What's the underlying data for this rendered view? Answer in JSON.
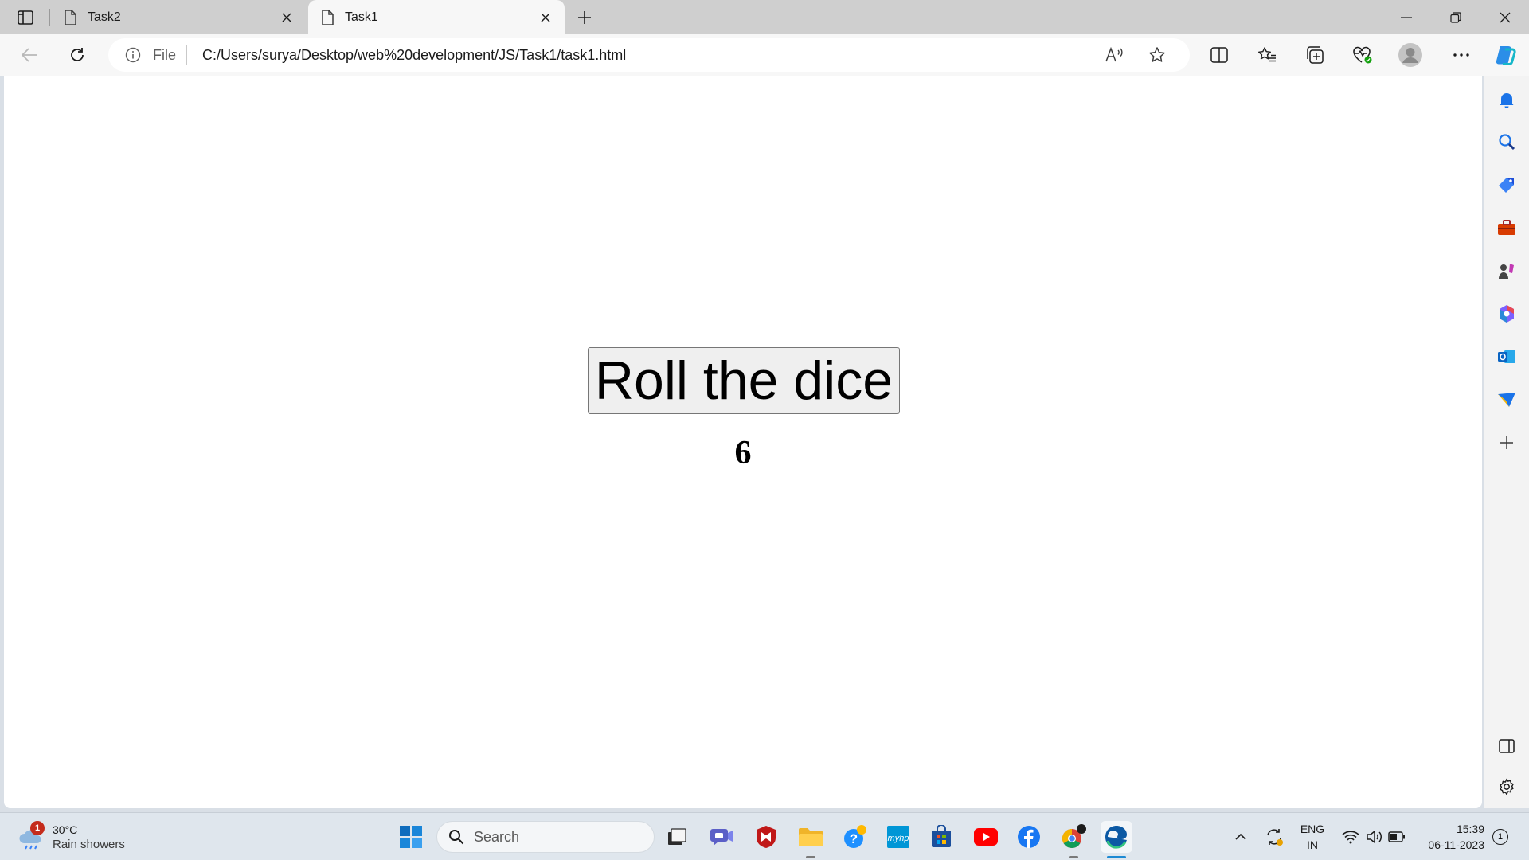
{
  "browser": {
    "tabs": [
      {
        "label": "Task2",
        "active": false
      },
      {
        "label": "Task1",
        "active": true
      }
    ],
    "address_bar": {
      "scheme_label": "File",
      "url": "C:/Users/surya/Desktop/web%20development/JS/Task1/task1.html"
    },
    "icons": {
      "tab_actions": "tab-actions-icon",
      "new_tab": "plus-icon",
      "back": "back-arrow-icon",
      "refresh": "refresh-icon",
      "read_aloud": "read-aloud-icon",
      "favorite": "star-icon",
      "split_screen": "split-screen-icon",
      "favorites": "favorites-icon",
      "collections": "collections-icon",
      "browser_essentials": "heart-pulse-icon",
      "profile": "profile-icon",
      "more": "more-icon",
      "copilot": "copilot-icon"
    },
    "accent": "#0078d4"
  },
  "page": {
    "button_label": "Roll the dice",
    "result": "6"
  },
  "sidebar": {
    "items": [
      "bell-icon",
      "search-icon",
      "tag-icon",
      "toolbox-icon",
      "games-icon",
      "office-icon",
      "outlook-icon",
      "send-icon",
      "add-icon",
      "panel-icon",
      "settings-icon"
    ]
  },
  "taskbar": {
    "weather": {
      "temp": "30°C",
      "condition": "Rain showers",
      "badge": "1"
    },
    "search_label": "Search",
    "language": {
      "line1": "ENG",
      "line2": "IN"
    },
    "clock": {
      "time": "15:39",
      "date": "06-11-2023"
    },
    "notifications": "1"
  }
}
